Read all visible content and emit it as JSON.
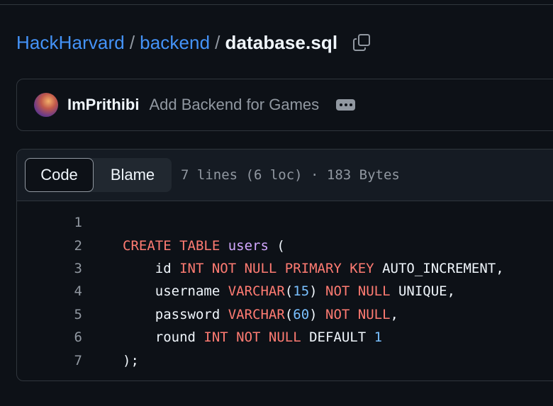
{
  "breadcrumb": {
    "repo": "HackHarvard",
    "folder": "backend",
    "separator": "/",
    "file": "database.sql",
    "copy_icon": "copy-icon"
  },
  "commit": {
    "author": "ImPrithibi",
    "message": "Add Backend for Games",
    "more_icon": "ellipsis-icon"
  },
  "file": {
    "tabs": [
      "Code",
      "Blame"
    ],
    "active_tab": "Code",
    "info": "7 lines (6 loc) · 183 Bytes"
  },
  "code_lines": [
    {
      "n": "1",
      "tokens": []
    },
    {
      "n": "2",
      "tokens": [
        {
          "t": "CREATE TABLE",
          "c": "kw"
        },
        {
          "t": " ",
          "c": ""
        },
        {
          "t": "users",
          "c": "ent"
        },
        {
          "t": " (",
          "c": ""
        }
      ]
    },
    {
      "n": "3",
      "tokens": [
        {
          "t": "    id ",
          "c": ""
        },
        {
          "t": "INT NOT NULL PRIMARY KEY",
          "c": "kw"
        },
        {
          "t": " AUTO_INCREMENT,",
          "c": ""
        }
      ]
    },
    {
      "n": "4",
      "tokens": [
        {
          "t": "    username ",
          "c": ""
        },
        {
          "t": "VARCHAR",
          "c": "kw"
        },
        {
          "t": "(",
          "c": ""
        },
        {
          "t": "15",
          "c": "num"
        },
        {
          "t": ") ",
          "c": ""
        },
        {
          "t": "NOT NULL",
          "c": "kw"
        },
        {
          "t": " UNIQUE,",
          "c": ""
        }
      ]
    },
    {
      "n": "5",
      "tokens": [
        {
          "t": "    password ",
          "c": ""
        },
        {
          "t": "VARCHAR",
          "c": "kw"
        },
        {
          "t": "(",
          "c": ""
        },
        {
          "t": "60",
          "c": "num"
        },
        {
          "t": ") ",
          "c": ""
        },
        {
          "t": "NOT NULL",
          "c": "kw"
        },
        {
          "t": ",",
          "c": ""
        }
      ]
    },
    {
      "n": "6",
      "tokens": [
        {
          "t": "    round ",
          "c": ""
        },
        {
          "t": "INT NOT NULL",
          "c": "kw"
        },
        {
          "t": " DEFAULT ",
          "c": ""
        },
        {
          "t": "1",
          "c": "num"
        }
      ]
    },
    {
      "n": "7",
      "tokens": [
        {
          "t": ");",
          "c": ""
        }
      ]
    }
  ],
  "colors": {
    "background": "#0d1117",
    "link": "#4493f8",
    "keyword": "#ff7b72",
    "entity": "#d2a8ff",
    "number": "#79c0ff"
  }
}
